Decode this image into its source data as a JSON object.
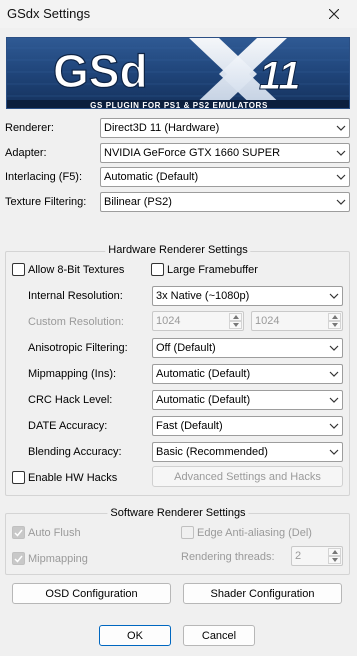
{
  "window": {
    "title": "GSdx Settings",
    "close_icon": "close-icon"
  },
  "banner": {
    "logo_text": "GSd",
    "logo_number": "11",
    "tagline": "GS PLUGIN FOR PS1 & PS2 EMULATORS"
  },
  "general": {
    "renderer_label": "Renderer:",
    "renderer_value": "Direct3D 11 (Hardware)",
    "adapter_label": "Adapter:",
    "adapter_value": "NVIDIA GeForce GTX 1660 SUPER",
    "interlacing_label": "Interlacing (F5):",
    "interlacing_value": "Automatic (Default)",
    "texture_filtering_label": "Texture Filtering:",
    "texture_filtering_value": "Bilinear (PS2)"
  },
  "hardware": {
    "title": "Hardware Renderer Settings",
    "allow_8bit_label": "Allow 8-Bit Textures",
    "large_framebuffer_label": "Large Framebuffer",
    "internal_resolution_label": "Internal Resolution:",
    "internal_resolution_value": "3x Native (~1080p)",
    "custom_resolution_label": "Custom Resolution:",
    "custom_res_w": "1024",
    "custom_res_h": "1024",
    "anisotropic_label": "Anisotropic Filtering:",
    "anisotropic_value": "Off (Default)",
    "mipmapping_label": "Mipmapping (Ins):",
    "mipmapping_value": "Automatic (Default)",
    "crc_label": "CRC Hack Level:",
    "crc_value": "Automatic (Default)",
    "date_label": "DATE Accuracy:",
    "date_value": "Fast (Default)",
    "blending_label": "Blending Accuracy:",
    "blending_value": "Basic (Recommended)",
    "enable_hw_hacks_label": "Enable HW Hacks",
    "advanced_button": "Advanced Settings and Hacks"
  },
  "software": {
    "title": "Software Renderer Settings",
    "auto_flush_label": "Auto Flush",
    "edge_aa_label": "Edge Anti-aliasing (Del)",
    "mipmapping_label": "Mipmapping",
    "rendering_threads_label": "Rendering threads:",
    "rendering_threads_value": "2"
  },
  "buttons": {
    "osd": "OSD Configuration",
    "shader": "Shader Configuration",
    "ok": "OK",
    "cancel": "Cancel"
  },
  "colors": {
    "banner_bg": "#1d3f73",
    "accent": "#0067c0"
  }
}
